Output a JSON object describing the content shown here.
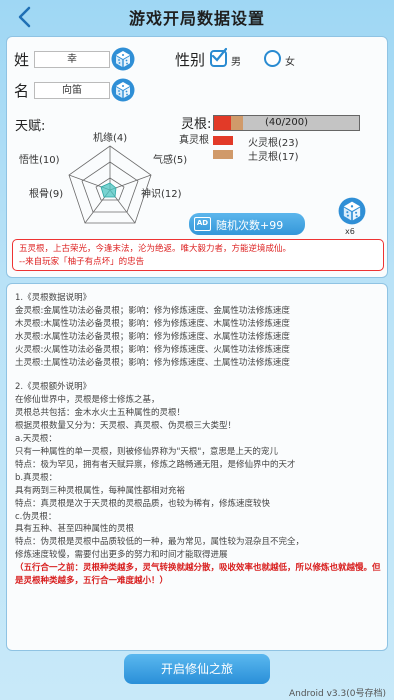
{
  "header": {
    "title": "游戏开局数据设置"
  },
  "identity": {
    "surname_label": "姓",
    "surname_value": "幸",
    "given_label": "名",
    "given_value": "向笛",
    "gender_label": "性别",
    "male": "男",
    "female": "女"
  },
  "talent": {
    "label": "天赋:",
    "stats": {
      "jiyuan": "机缘(4)",
      "ganzhi": "气感(5)",
      "shenshi": "神识(12)",
      "gengu": "根骨(9)",
      "wuxing": "悟性(10)"
    }
  },
  "spirit_root": {
    "label": "灵根:",
    "type": "真灵根",
    "progress_text": "(40/200)",
    "total": 40,
    "max": 200,
    "items": [
      {
        "label": "火灵根(23)",
        "value": 23,
        "color": "#e23a28"
      },
      {
        "label": "土灵根(17)",
        "value": 17,
        "color": "#d09a6a"
      }
    ]
  },
  "actions": {
    "random_ad": "AD",
    "random_label": "随机次数+99",
    "dice_count": "x6",
    "start_label": "开启修仙之旅"
  },
  "quote": {
    "line1": "五灵根，上古荣光，今逢末法，沦为绝返。唯大毅力者，方能逆境成仙。",
    "line2": "--来自玩家「柚子有点坏」的忠告"
  },
  "info": {
    "lines": [
      "1.《灵根数据说明》",
      "金灵根:金属性功法必备灵根；影响：修为修炼速度、金属性功法修炼速度",
      "木灵根:木属性功法必备灵根；影响：修为修炼速度、木属性功法修炼速度",
      "水灵根:水属性功法必备灵根；影响：修为修炼速度、水属性功法修炼速度",
      "火灵根:火属性功法必备灵根；影响：修为修炼速度、火属性功法修炼速度",
      "土灵根:土属性功法必备灵根；影响：修为修炼速度、土属性功法修炼速度",
      "",
      "2.《灵根额外说明》",
      "在修仙世界中，灵根是修士修炼之基，",
      "灵根总共包括：金木水火土五种属性的灵根！",
      "根据灵根数量又分为：天灵根、真灵根、伪灵根三大类型！",
      "a.天灵根：",
      "只有一种属性的单一灵根，则被修仙界称为\"天根\"，意思是上天的宠儿",
      "特点：极为罕见，拥有者天赋异禀，修炼之路畅通无阻，是修仙界中的天才",
      "b.真灵根：",
      "具有两到三种灵根属性，每种属性都相对充裕",
      "特点：真灵根是次于天灵根的灵根品质，也较为稀有，修炼速度较快",
      "c.伪灵根：",
      "具有五种、甚至四种属性的灵根",
      "特点：伪灵根是灵根中品质较低的一种，最为常见，属性较为混杂且不完全，",
      "修炼速度较慢，需要付出更多的努力和时间才能取得进展"
    ],
    "warning": "（五行合一之前：灵根种类越多，灵气转换就越分散，吸收效率也就越低，所以修炼也就越慢。但是灵根种类越多，五行合一难度越小！）"
  },
  "footer": {
    "version": "Android v3.3(0号存档)"
  }
}
